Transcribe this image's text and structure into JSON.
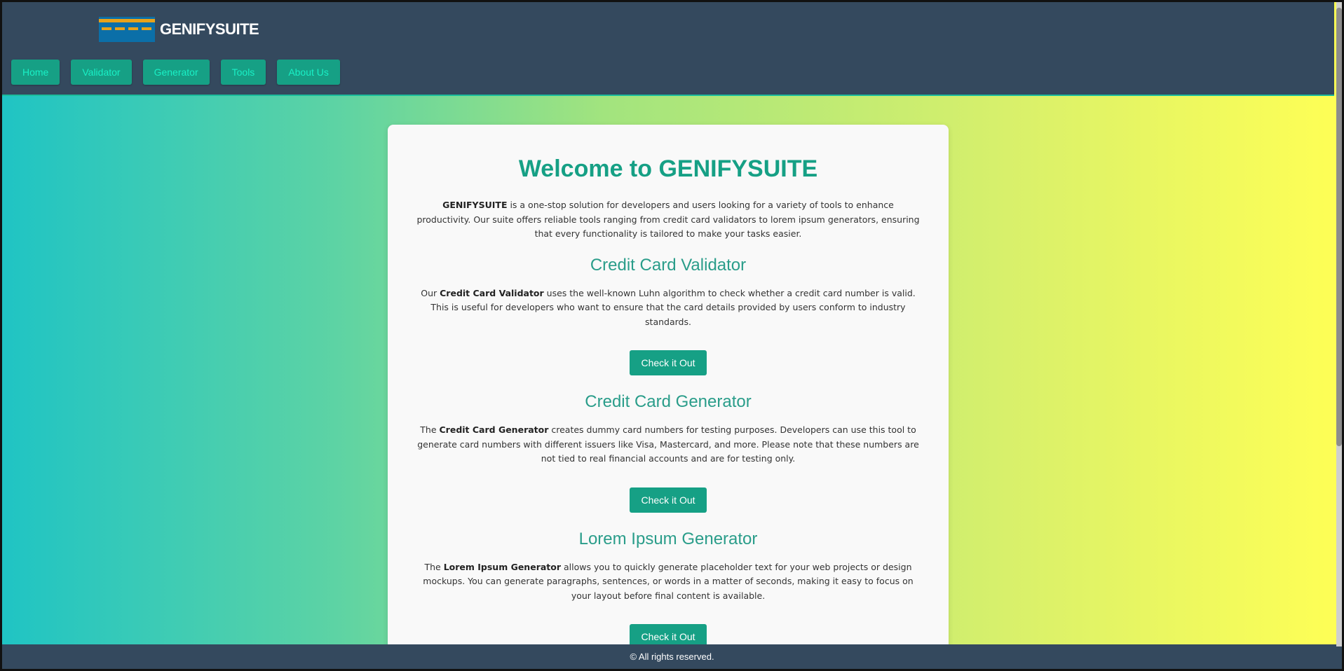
{
  "header": {
    "brand": "GENIFYSUITE",
    "logo_icon": "credit-card-logo-icon",
    "nav": [
      {
        "label": "Home"
      },
      {
        "label": "Validator"
      },
      {
        "label": "Generator"
      },
      {
        "label": "Tools"
      },
      {
        "label": "About Us"
      }
    ]
  },
  "main": {
    "title": "Welcome to GENIFYSUITE",
    "intro": {
      "strong": "GENIFYSUITE",
      "text": " is a one-stop solution for developers and users looking for a variety of tools to enhance productivity. Our suite offers reliable tools ranging from credit card validators to lorem ipsum generators, ensuring that every functionality is tailored to make your tasks easier."
    },
    "sections": [
      {
        "heading": "Credit Card Validator",
        "pre": "Our ",
        "strong": "Credit Card Validator",
        "post": " uses the well-known Luhn algorithm to check whether a credit card number is valid. This is useful for developers who want to ensure that the card details provided by users conform to industry standards.",
        "button": "Check it Out"
      },
      {
        "heading": "Credit Card Generator",
        "pre": "The ",
        "strong": "Credit Card Generator",
        "post": " creates dummy card numbers for testing purposes. Developers can use this tool to generate card numbers with different issuers like Visa, Mastercard, and more. Please note that these numbers are not tied to real financial accounts and are for testing only.",
        "button": "Check it Out"
      },
      {
        "heading": "Lorem Ipsum Generator",
        "pre": "The ",
        "strong": "Lorem Ipsum Generator",
        "post": " allows you to quickly generate placeholder text for your web projects or design mockups. You can generate paragraphs, sentences, or words in a matter of seconds, making it easy to focus on your layout before final content is available.",
        "button": "Check it Out"
      }
    ]
  },
  "footer": {
    "text": "© All rights reserved."
  },
  "colors": {
    "header_bg": "#34495e",
    "accent": "#16a085",
    "nav_text": "#19f0c6",
    "logo_blue": "#0b6fa8",
    "logo_stripe": "#e8a21a"
  }
}
